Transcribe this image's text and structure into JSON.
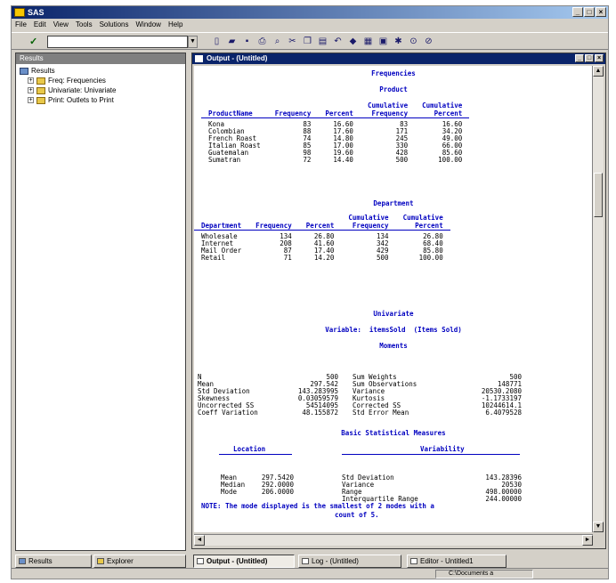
{
  "window": {
    "title": "SAS"
  },
  "menu": [
    "File",
    "Edit",
    "View",
    "Tools",
    "Solutions",
    "Window",
    "Help"
  ],
  "toolbar": {
    "command_value": ""
  },
  "results_pane": {
    "title": "Results",
    "root": "Results",
    "items": [
      "Freq: Frequencies",
      "Univariate: Univariate",
      "Print: Outlets to Print"
    ]
  },
  "output_window": {
    "title": "Output - (Untitled)",
    "main_title": "Frequencies",
    "product": {
      "title": "Product",
      "headers": [
        "ProductName",
        "Frequency",
        "Percent",
        "Cumulative\nFrequency",
        "Cumulative\nPercent"
      ],
      "rows": [
        [
          "Kona",
          "83",
          "16.60",
          "83",
          "16.60"
        ],
        [
          "Colombian",
          "88",
          "17.60",
          "171",
          "34.20"
        ],
        [
          "French Roast",
          "74",
          "14.80",
          "245",
          "49.00"
        ],
        [
          "Italian Roast",
          "85",
          "17.00",
          "330",
          "66.00"
        ],
        [
          "Guatemalan",
          "98",
          "19.60",
          "428",
          "85.60"
        ],
        [
          "Sumatran",
          "72",
          "14.40",
          "500",
          "100.00"
        ]
      ]
    },
    "department": {
      "title": "Department",
      "headers": [
        "Department",
        "Frequency",
        "Percent",
        "Cumulative\nFrequency",
        "Cumulative\nPercent"
      ],
      "rows": [
        [
          "Wholesale",
          "134",
          "26.80",
          "134",
          "26.80"
        ],
        [
          "Internet",
          "208",
          "41.60",
          "342",
          "68.40"
        ],
        [
          "Mail Order",
          "87",
          "17.40",
          "429",
          "85.80"
        ],
        [
          "Retail",
          "71",
          "14.20",
          "500",
          "100.00"
        ]
      ]
    },
    "univariate": {
      "title": "Univariate",
      "variable": "Variable:  itemsSold  (Items Sold)",
      "moments_title": "Moments",
      "moments_left": [
        [
          "N",
          "500"
        ],
        [
          "Mean",
          "297.542"
        ],
        [
          "Std Deviation",
          "143.283995"
        ],
        [
          "Skewness",
          "0.03059579"
        ],
        [
          "Uncorrected SS",
          "54514095"
        ],
        [
          "Coeff Variation",
          "48.155872"
        ]
      ],
      "moments_right": [
        [
          "Sum Weights",
          "500"
        ],
        [
          "Sum Observations",
          "148771"
        ],
        [
          "Variance",
          "20530.2080"
        ],
        [
          "Kurtosis",
          "-1.1733197"
        ],
        [
          "Corrected SS",
          "10244614.1"
        ],
        [
          "Std Error Mean",
          "6.4079528"
        ]
      ],
      "basic_title": "Basic Statistical Measures",
      "location_header": "Location",
      "variability_header": "Variability",
      "location": [
        [
          "Mean",
          "297.5420"
        ],
        [
          "Median",
          "292.0000"
        ],
        [
          "Mode",
          "206.0000"
        ]
      ],
      "variability": [
        [
          "Std Deviation",
          "143.28396"
        ],
        [
          "Variance",
          "20530"
        ],
        [
          "Range",
          "498.00000"
        ],
        [
          "Interquartile Range",
          "244.00000"
        ]
      ],
      "note": "NOTE: The mode displayed is the smallest of 2 modes with a",
      "note2": "count of 5."
    }
  },
  "window_tabs": {
    "results": "Results",
    "explorer": "Explorer",
    "output": "Output - (Untitled)",
    "log": "Log - (Untitled)",
    "editor": "Editor - Untitled1"
  },
  "status": {
    "path": "C:\\Documents a"
  }
}
